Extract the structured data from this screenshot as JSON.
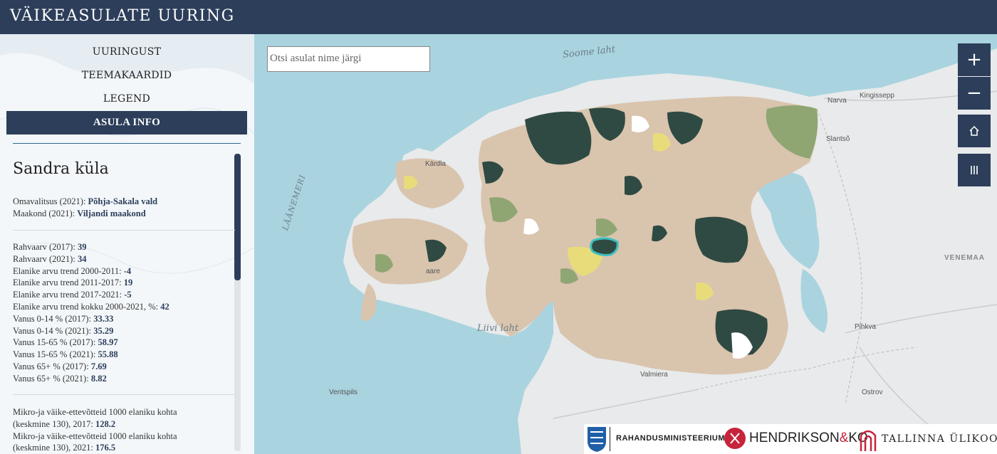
{
  "header": {
    "title": "VÄIKEASULATE UURING"
  },
  "nav": {
    "items": [
      {
        "label": "UURINGUST"
      },
      {
        "label": "TEEMAKAARDID"
      },
      {
        "label": "LEGEND"
      },
      {
        "label": "ASULA INFO"
      }
    ]
  },
  "info": {
    "place_name": "Sandra küla",
    "admin": [
      {
        "label": "Omavalitsus (2021): ",
        "value": "Põhja-Sakala vald"
      },
      {
        "label": "Maakond (2021): ",
        "value": "Viljandi maakond"
      }
    ],
    "stats": [
      {
        "label": "Rahvaarv (2017): ",
        "value": "39"
      },
      {
        "label": "Rahvaarv (2021): ",
        "value": "34"
      },
      {
        "label": "Elanike arvu trend 2000-2011: ",
        "value": "-4"
      },
      {
        "label": "Elanike arvu trend 2011-2017: ",
        "value": "19"
      },
      {
        "label": "Elanike arvu trend 2017-2021: ",
        "value": "-5"
      },
      {
        "label": "Elanike arvu trend kokku 2000-2021, %: ",
        "value": "42"
      },
      {
        "label": "Vanus 0-14 % (2017): ",
        "value": "33.33"
      },
      {
        "label": "Vanus 0-14 % (2021): ",
        "value": "35.29"
      },
      {
        "label": "Vanus 15-65 % (2017): ",
        "value": "58.97"
      },
      {
        "label": "Vanus 15-65 % (2021): ",
        "value": "55.88"
      },
      {
        "label": "Vanus 65+ % (2017): ",
        "value": "7.69"
      },
      {
        "label": "Vanus 65+ % (2021): ",
        "value": "8.82"
      }
    ],
    "business": [
      {
        "line1": "Mikro-ja väike-ettevõtteid 1000 elaniku kohta",
        "line2_label": "(keskmine 130), 2017: ",
        "value": "128.2"
      },
      {
        "line1": "Mikro-ja väike-ettevõtteid 1000 elaniku kohta",
        "line2_label": "(keskmine 130), 2021: ",
        "value": "176.5"
      }
    ]
  },
  "map": {
    "search_placeholder": "Otsi asulat nime järgi",
    "controls": {
      "zoom_in": "+",
      "zoom_out": "−"
    },
    "sea_labels": {
      "gulf_finland": "Soome laht",
      "baltic": "LÄÄNEMERI",
      "gulf_riga": "Liivi laht"
    },
    "place_labels": {
      "kardla": "Kärdla",
      "kuressaare": "aare",
      "narva": "Narva",
      "kingissepp": "Kingissepp",
      "slantso": "Slantsõ",
      "venemaa": "VENEMAA",
      "pihkva": "Pihkva",
      "valmiera": "Valmiera",
      "ventspils": "Ventspils",
      "ostrov": "Ostrov"
    },
    "colors": {
      "sea": "#a9d3df",
      "land": "#e8eaeb",
      "dark_green": "#2f4a42",
      "light_green": "#8fa673",
      "tan": "#d9c4ae",
      "yellow": "#e8dc7a",
      "highlight": "#3fbfbf",
      "header_bg": "#2c3e5a"
    }
  },
  "logos": {
    "ministry": "RAHANDUSMINISTEERIUM",
    "hendrikson": "HENDRIKSON",
    "hendrikson_amp": "&",
    "hendrikson_ko": "KO",
    "tlu": "TALLINNA ÜLIKOOL"
  }
}
